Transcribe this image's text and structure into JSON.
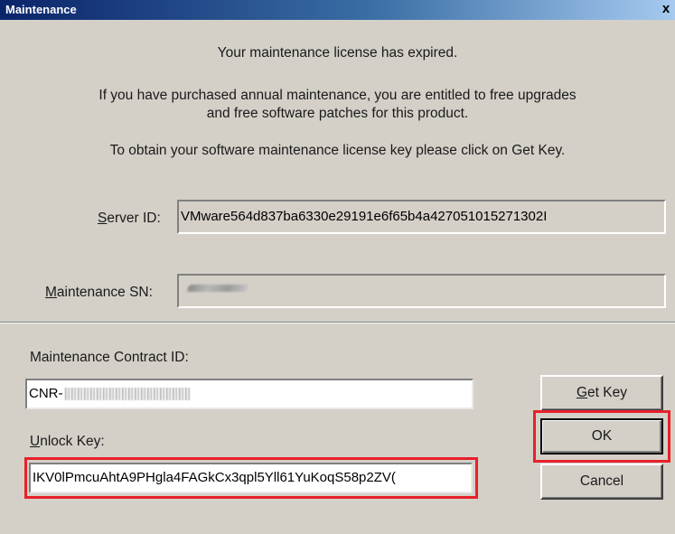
{
  "window": {
    "title": "Maintenance",
    "close_glyph": "x",
    "close_icon": "close-icon"
  },
  "messages": {
    "line1": "Your maintenance license has expired.",
    "line2a": "If you have purchased annual maintenance, you are entitled to free upgrades",
    "line2b": "and free software patches for this product.",
    "line3": "To obtain your software maintenance license key please click on Get Key."
  },
  "server_id": {
    "label_accel": "S",
    "label_rest": "erver ID:",
    "value": "VMware564d837ba6330e29191e6f65b4a427051015271302I"
  },
  "maintenance_sn": {
    "label_accel": "M",
    "label_rest": "aintenance SN:",
    "value": ""
  },
  "contract": {
    "label": "Maintenance Contract ID:",
    "value_visible_prefix": "CNR-"
  },
  "unlock": {
    "label_accel": "U",
    "label_rest": "nlock Key:",
    "value": "IKV0lPmcuAhtA9PHgla4FAGkCx3qpl5Yll61YuKoqS58p2ZV("
  },
  "buttons": {
    "get_key_accel": "G",
    "get_key_rest": "et Key",
    "ok": "OK",
    "cancel": "Cancel"
  },
  "highlight_color": "#e8202a"
}
